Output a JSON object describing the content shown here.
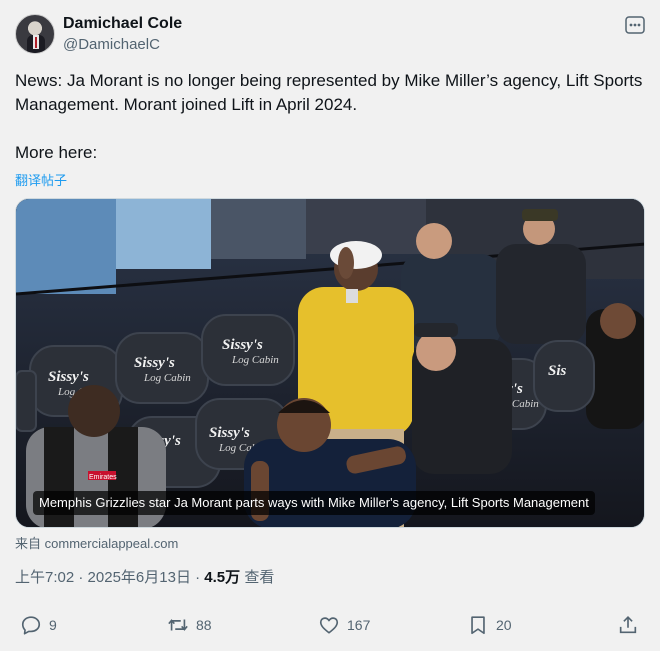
{
  "author": {
    "name": "Damichael Cole",
    "handle": "@DamichaelC"
  },
  "tweet": {
    "text": "News: Ja Morant is no longer being represented by Mike Miller’s agency, Lift Sports Management. Morant joined Lift in April 2024.\n\nMore here:",
    "translate_label": "翻译帖子"
  },
  "media": {
    "caption": "Memphis Grizzlies star Ja Morant parts ways with Mike Miller's agency, Lift Sports Management",
    "seat_text": "Sissy's Log Cabin",
    "jersey_text": "Emirates"
  },
  "source": {
    "prefix": "来自",
    "domain": "commercialappeal.com"
  },
  "meta": {
    "time": "上午7:02",
    "date": "2025年6月13日",
    "sep": " · ",
    "views_count": "4.5万",
    "views_label": "查看"
  },
  "actions": {
    "replies": "9",
    "reposts": "88",
    "likes": "167",
    "bookmarks": "20"
  },
  "icons": {
    "more": "more-horizontal-icon",
    "reply": "reply-icon",
    "repost": "repost-icon",
    "like": "heart-icon",
    "bookmark": "bookmark-icon",
    "share": "share-icon"
  },
  "colors": {
    "link": "#1d9bf0",
    "muted": "#536471",
    "text": "#0f1419",
    "background": "#f1f1f1"
  }
}
